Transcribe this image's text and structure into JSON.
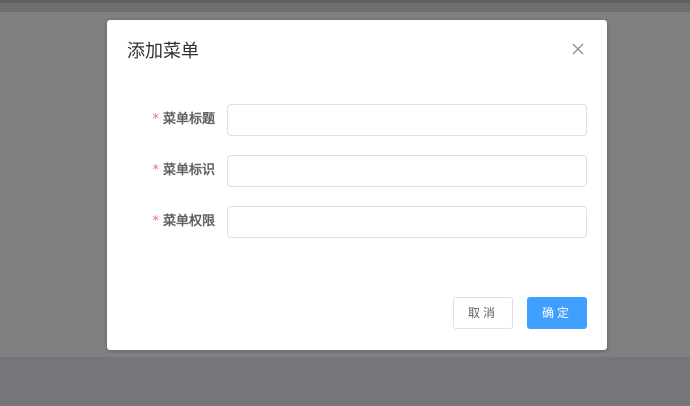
{
  "dialog": {
    "title": "添加菜单",
    "close_icon": "close-icon"
  },
  "form": {
    "required_mark": "*",
    "fields": [
      {
        "label": "菜单标题",
        "value": "",
        "placeholder": ""
      },
      {
        "label": "菜单标识",
        "value": "",
        "placeholder": ""
      },
      {
        "label": "菜单权限",
        "value": "",
        "placeholder": ""
      }
    ]
  },
  "footer": {
    "cancel_label": "取消",
    "confirm_label": "确定"
  },
  "colors": {
    "primary": "#409eff",
    "required": "#f56c6c",
    "overlay": "#808080"
  }
}
